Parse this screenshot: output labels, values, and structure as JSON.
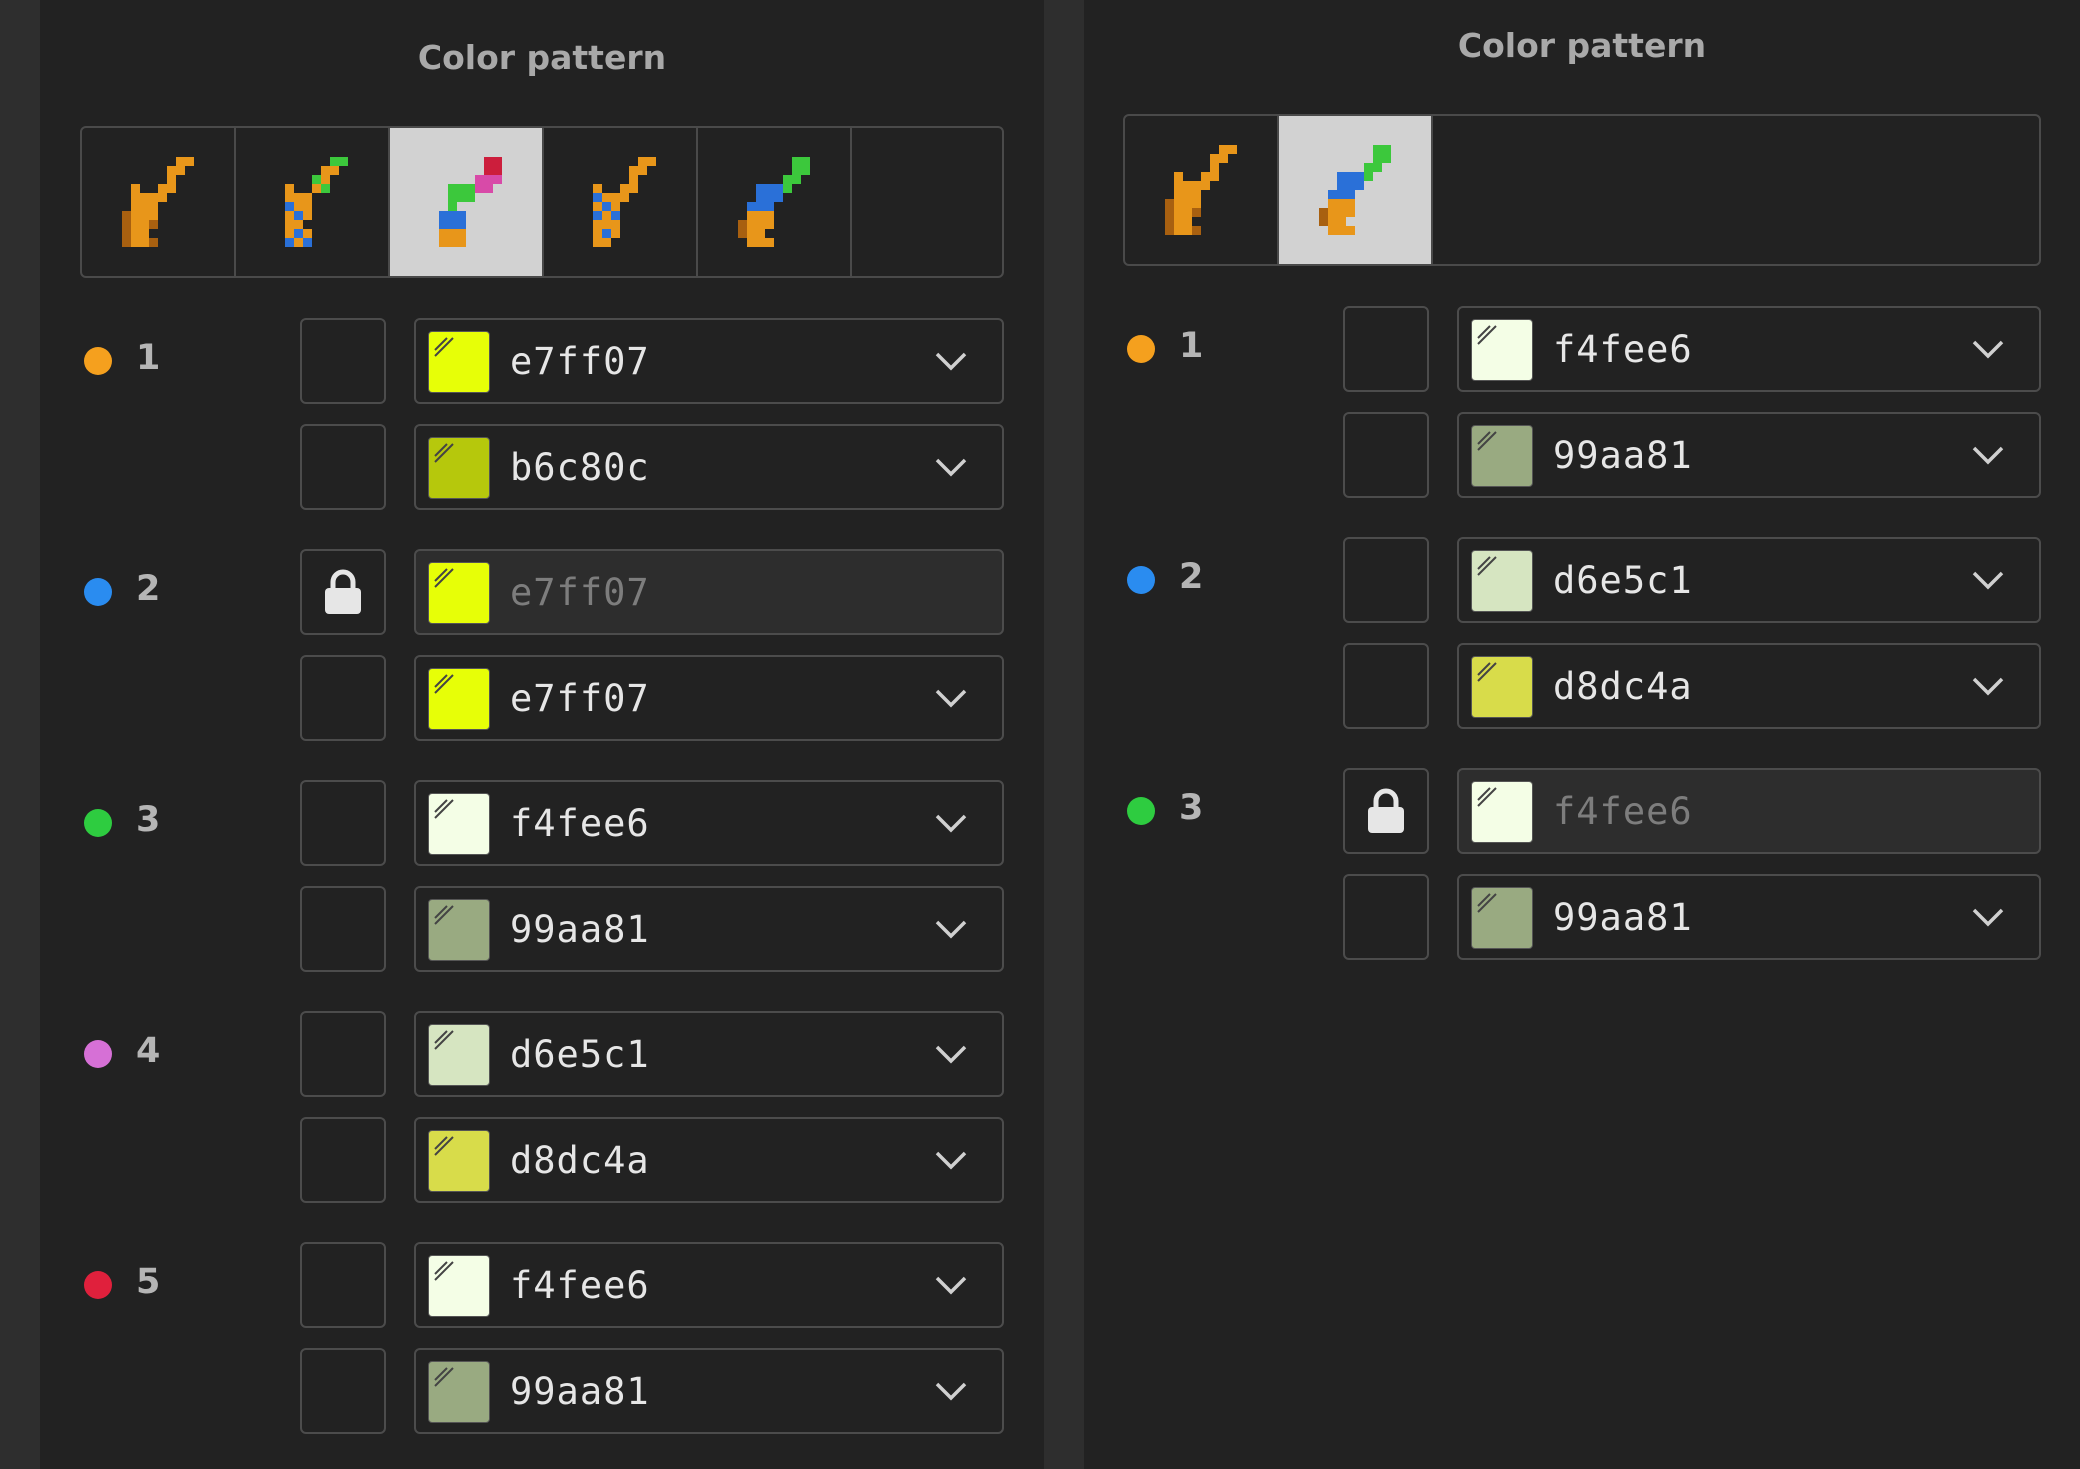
{
  "left_panel": {
    "title": "Color pattern",
    "variants": [
      {
        "icon": "brush-icon-orange",
        "selected": false
      },
      {
        "icon": "brush-icon-orange-green-blue",
        "selected": false
      },
      {
        "icon": "brush-icon-multicolor",
        "selected": true
      },
      {
        "icon": "brush-icon-orange-blue",
        "selected": false
      },
      {
        "icon": "brush-icon-blue-green",
        "selected": false
      }
    ],
    "rows": [
      {
        "num": "1",
        "dot": "#f5a01e",
        "colors": [
          {
            "hex": "e7ff07",
            "swatch": "#e7ff07",
            "locked": false
          },
          {
            "hex": "b6c80c",
            "swatch": "#b6c80c",
            "locked": false
          }
        ]
      },
      {
        "num": "2",
        "dot": "#2a8cf0",
        "colors": [
          {
            "hex": "e7ff07",
            "swatch": "#e7ff07",
            "locked": true
          },
          {
            "hex": "e7ff07",
            "swatch": "#e7ff07",
            "locked": false
          }
        ]
      },
      {
        "num": "3",
        "dot": "#2ecc40",
        "colors": [
          {
            "hex": "f4fee6",
            "swatch": "#f4fee6",
            "locked": false
          },
          {
            "hex": "99aa81",
            "swatch": "#99aa81",
            "locked": false
          }
        ]
      },
      {
        "num": "4",
        "dot": "#d670d6",
        "colors": [
          {
            "hex": "d6e5c1",
            "swatch": "#d6e5c1",
            "locked": false
          },
          {
            "hex": "d8dc4a",
            "swatch": "#d8dc4a",
            "locked": false
          }
        ]
      },
      {
        "num": "5",
        "dot": "#e0203c",
        "colors": [
          {
            "hex": "f4fee6",
            "swatch": "#f4fee6",
            "locked": false
          },
          {
            "hex": "99aa81",
            "swatch": "#99aa81",
            "locked": false
          }
        ]
      }
    ]
  },
  "right_panel": {
    "title": "Color pattern",
    "variants": [
      {
        "icon": "brush-icon-orange",
        "selected": false
      },
      {
        "icon": "brush-icon-blue-green",
        "selected": true
      }
    ],
    "rows": [
      {
        "num": "1",
        "dot": "#f5a01e",
        "colors": [
          {
            "hex": "f4fee6",
            "swatch": "#f4fee6",
            "locked": false
          },
          {
            "hex": "99aa81",
            "swatch": "#99aa81",
            "locked": false
          }
        ]
      },
      {
        "num": "2",
        "dot": "#2a8cf0",
        "colors": [
          {
            "hex": "d6e5c1",
            "swatch": "#d6e5c1",
            "locked": false
          },
          {
            "hex": "d8dc4a",
            "swatch": "#d8dc4a",
            "locked": false
          }
        ]
      },
      {
        "num": "3",
        "dot": "#2ecc40",
        "colors": [
          {
            "hex": "f4fee6",
            "swatch": "#f4fee6",
            "locked": true
          },
          {
            "hex": "99aa81",
            "swatch": "#99aa81",
            "locked": false
          }
        ]
      }
    ]
  }
}
